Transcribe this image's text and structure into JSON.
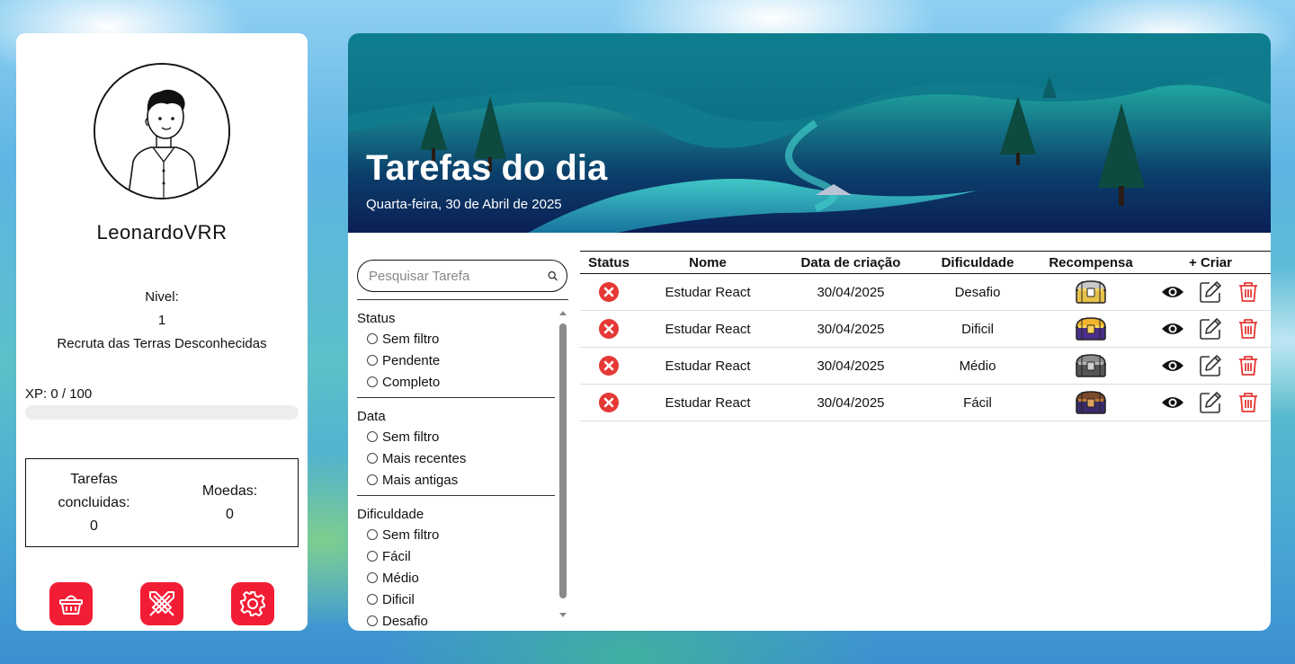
{
  "profile": {
    "username": "LeonardoVRR",
    "level_label": "Nivel:",
    "level_value": "1",
    "rank": "Recruta das Terras Desconhecidas",
    "xp_text": "XP: 0 / 100",
    "xp_progress": 0,
    "tasks_done_label": "Tarefas concluidas:",
    "tasks_done_value": "0",
    "coins_label": "Moedas:",
    "coins_value": "0",
    "actions": [
      {
        "icon": "shop-basket-icon"
      },
      {
        "icon": "sword-crossed-icon"
      },
      {
        "icon": "gear-icon"
      }
    ]
  },
  "banner": {
    "title": "Tarefas do dia",
    "date": "Quarta-feira, 30 de Abril de 2025"
  },
  "search": {
    "placeholder": "Pesquisar Tarefa"
  },
  "filters": {
    "status": {
      "title": "Status",
      "options": [
        "Sem filtro",
        "Pendente",
        "Completo"
      ]
    },
    "data": {
      "title": "Data",
      "options": [
        "Sem filtro",
        "Mais recentes",
        "Mais antigas"
      ]
    },
    "dificuldade": {
      "title": "Dificuldade",
      "options": [
        "Sem filtro",
        "Fácil",
        "Médio",
        "Dificil",
        "Desafio"
      ]
    }
  },
  "table": {
    "headers": [
      "Status",
      "Nome",
      "Data de criação",
      "Dificuldade",
      "Recompensa",
      "+ Criar"
    ],
    "rows": [
      {
        "name": "Estudar React",
        "date": "30/04/2025",
        "difficulty": "Desafio",
        "chest": "silver-gold"
      },
      {
        "name": "Estudar React",
        "date": "30/04/2025",
        "difficulty": "Dificil",
        "chest": "gold"
      },
      {
        "name": "Estudar React",
        "date": "30/04/2025",
        "difficulty": "Médio",
        "chest": "iron"
      },
      {
        "name": "Estudar React",
        "date": "30/04/2025",
        "difficulty": "Fácil",
        "chest": "wood"
      }
    ]
  },
  "colors": {
    "accent": "#f21d35",
    "status_x": "#e53935",
    "delete": "#e53935"
  }
}
